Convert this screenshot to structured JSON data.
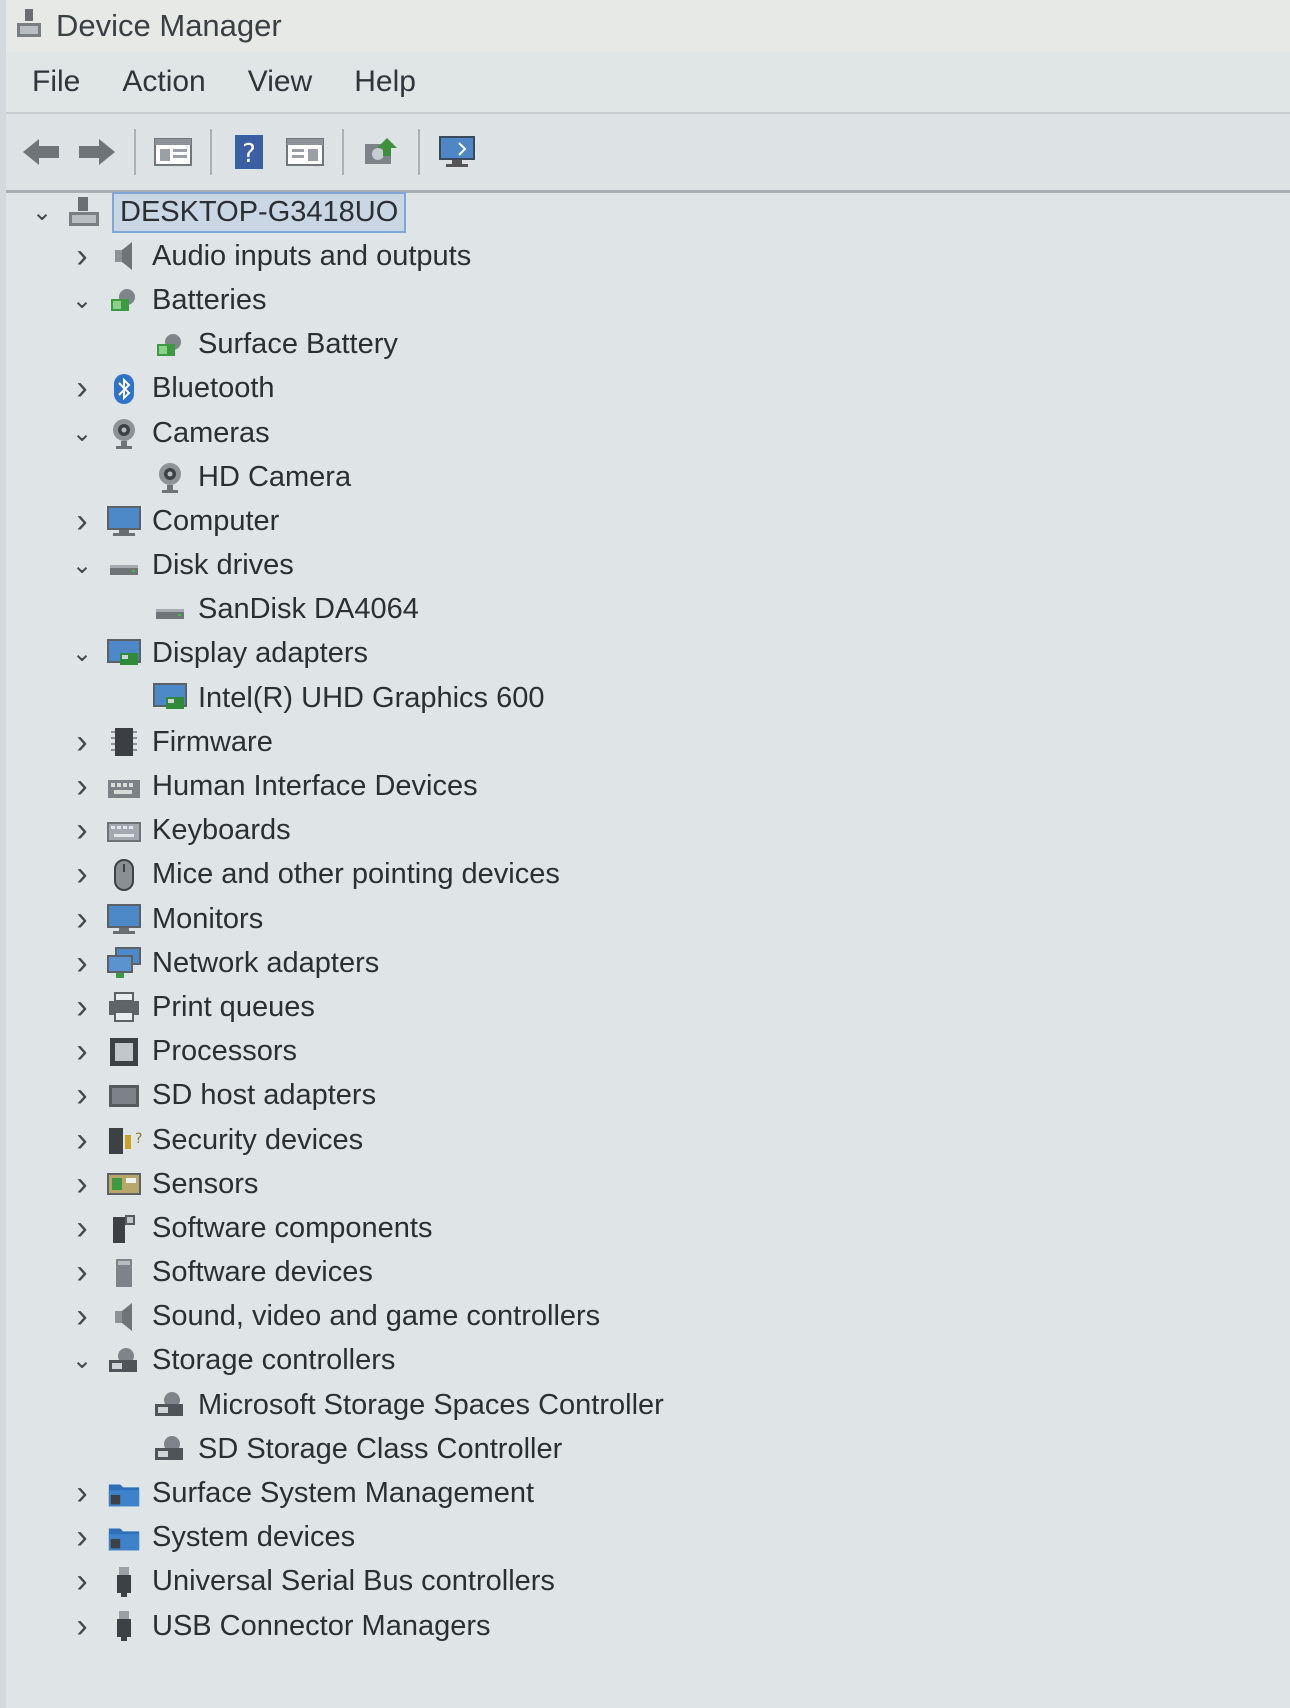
{
  "window": {
    "title": "Device Manager"
  },
  "menu": {
    "file": "File",
    "action": "Action",
    "view": "View",
    "help": "Help"
  },
  "toolbar": {
    "icons": [
      "back-arrow-icon",
      "forward-arrow-icon",
      "properties-panel-icon",
      "help-icon",
      "update-driver-panel-icon",
      "scan-hardware-icon",
      "monitor-icon"
    ]
  },
  "tree": {
    "root": {
      "label": "DESKTOP-G3418UO",
      "expanded": true
    },
    "categories": [
      {
        "label": "Audio inputs and outputs",
        "expanded": false,
        "icon": "speaker-icon"
      },
      {
        "label": "Batteries",
        "expanded": true,
        "icon": "battery-icon",
        "children": [
          "Surface Battery"
        ]
      },
      {
        "label": "Bluetooth",
        "expanded": false,
        "icon": "bluetooth-icon"
      },
      {
        "label": "Cameras",
        "expanded": true,
        "icon": "camera-icon",
        "children": [
          "HD Camera"
        ]
      },
      {
        "label": "Computer",
        "expanded": false,
        "icon": "computer-icon"
      },
      {
        "label": "Disk drives",
        "expanded": true,
        "icon": "disk-drive-icon",
        "children": [
          "SanDisk DA4064"
        ]
      },
      {
        "label": "Display adapters",
        "expanded": true,
        "icon": "display-adapter-icon",
        "children": [
          "Intel(R) UHD Graphics 600"
        ]
      },
      {
        "label": "Firmware",
        "expanded": false,
        "icon": "firmware-chip-icon"
      },
      {
        "label": "Human Interface Devices",
        "expanded": false,
        "icon": "hid-icon"
      },
      {
        "label": "Keyboards",
        "expanded": false,
        "icon": "keyboard-icon"
      },
      {
        "label": "Mice and other pointing devices",
        "expanded": false,
        "icon": "mouse-icon"
      },
      {
        "label": "Monitors",
        "expanded": false,
        "icon": "monitor-icon"
      },
      {
        "label": "Network adapters",
        "expanded": false,
        "icon": "network-adapter-icon"
      },
      {
        "label": "Print queues",
        "expanded": false,
        "icon": "printer-icon"
      },
      {
        "label": "Processors",
        "expanded": false,
        "icon": "processor-icon"
      },
      {
        "label": "SD host adapters",
        "expanded": false,
        "icon": "sd-host-icon"
      },
      {
        "label": "Security devices",
        "expanded": false,
        "icon": "security-device-icon"
      },
      {
        "label": "Sensors",
        "expanded": false,
        "icon": "sensor-icon"
      },
      {
        "label": "Software components",
        "expanded": false,
        "icon": "software-component-icon"
      },
      {
        "label": "Software devices",
        "expanded": false,
        "icon": "software-device-icon"
      },
      {
        "label": "Sound, video and game controllers",
        "expanded": false,
        "icon": "speaker-icon"
      },
      {
        "label": "Storage controllers",
        "expanded": true,
        "icon": "storage-controller-icon",
        "children": [
          "Microsoft Storage Spaces Controller",
          "SD Storage Class Controller"
        ]
      },
      {
        "label": "Surface System Management",
        "expanded": false,
        "icon": "system-folder-icon"
      },
      {
        "label": "System devices",
        "expanded": false,
        "icon": "system-folder-icon"
      },
      {
        "label": "Universal Serial Bus controllers",
        "expanded": false,
        "icon": "usb-icon"
      },
      {
        "label": "USB Connector Managers",
        "expanded": false,
        "icon": "usb-icon"
      }
    ]
  }
}
